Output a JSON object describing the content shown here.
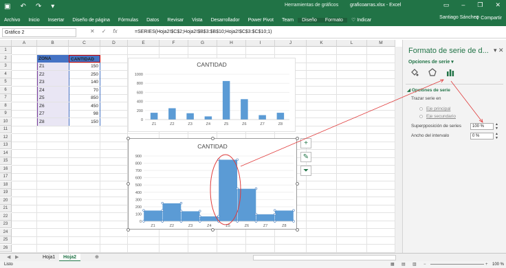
{
  "titlebar": {
    "context_title": "Herramientas de gráficos",
    "window_title": "graficoarras.xlsx - Excel",
    "user": "Santiago Sánchez",
    "share": "Compartir"
  },
  "ribbon": {
    "tabs": [
      "Archivo",
      "Inicio",
      "Insertar",
      "Diseño de página",
      "Fórmulas",
      "Datos",
      "Revisar",
      "Vista",
      "Desarrollador",
      "Power Pivot",
      "Team"
    ],
    "context_tabs": [
      "Diseño",
      "Formato"
    ],
    "tell_me": "Indicar"
  },
  "formula_bar": {
    "name_box": "Gráfico 2",
    "formula": "=SERIES(Hoja2!$C$2;Hoja2!$B$3:$B$10;Hoja2!$C$3:$C$10;1)"
  },
  "columns": [
    "A",
    "B",
    "C",
    "D",
    "E",
    "F",
    "G",
    "H",
    "I",
    "J",
    "K",
    "L",
    "M"
  ],
  "rows": [
    "1",
    "2",
    "3",
    "4",
    "5",
    "6",
    "7",
    "8",
    "9",
    "10",
    "11",
    "12",
    "13",
    "14",
    "15",
    "16",
    "17",
    "18",
    "19",
    "20",
    "21",
    "22",
    "23",
    "24",
    "25",
    "26"
  ],
  "table": {
    "headers": [
      "ZONA",
      "CANTIDAD"
    ],
    "rows": [
      [
        "Z1",
        "150"
      ],
      [
        "Z2",
        "250"
      ],
      [
        "Z3",
        "140"
      ],
      [
        "Z4",
        "70"
      ],
      [
        "Z5",
        "850"
      ],
      [
        "Z6",
        "450"
      ],
      [
        "Z7",
        "98"
      ],
      [
        "Z8",
        "150"
      ]
    ]
  },
  "chart_data": [
    {
      "type": "bar",
      "title": "CANTIDAD",
      "categories": [
        "Z1",
        "Z2",
        "Z3",
        "Z4",
        "Z5",
        "Z6",
        "Z7",
        "Z8"
      ],
      "values": [
        150,
        250,
        140,
        70,
        850,
        450,
        98,
        150
      ],
      "ylim": [
        0,
        1000
      ],
      "yticks": [
        "0",
        "200",
        "400",
        "600",
        "800",
        "1000"
      ],
      "color": "#5b9bd5",
      "gap_width": "default"
    },
    {
      "type": "bar",
      "title": "CANTIDAD",
      "categories": [
        "Z1",
        "Z2",
        "Z3",
        "Z4",
        "Z5",
        "Z6",
        "Z7",
        "Z8"
      ],
      "values": [
        150,
        250,
        140,
        70,
        850,
        450,
        98,
        150
      ],
      "ylim": [
        0,
        900
      ],
      "yticks": [
        "0",
        "100",
        "200",
        "300",
        "400",
        "500",
        "600",
        "700",
        "800",
        "900"
      ],
      "color": "#5b9bd5",
      "gap_width": "0 %"
    }
  ],
  "pane": {
    "title": "Formato de serie de d...",
    "options_label": "Opciones de serie",
    "section": "Opciones de serie",
    "plot_on": "Trazar serie en",
    "primary_axis": "Eje principal",
    "secondary_axis": "Eje secundario",
    "overlap_label": "Superpposición de series",
    "overlap_value": "100 %",
    "gap_label": "Ancho del intervalo",
    "gap_value": "0 %"
  },
  "sheets": {
    "tabs": [
      "Hoja1",
      "Hoja2"
    ],
    "active": "Hoja2"
  },
  "status": {
    "left": "Listo",
    "zoom": "100 %"
  },
  "colors": {
    "accent": "#217346",
    "bar": "#5b9bd5",
    "annotation": "#e03b3b"
  }
}
